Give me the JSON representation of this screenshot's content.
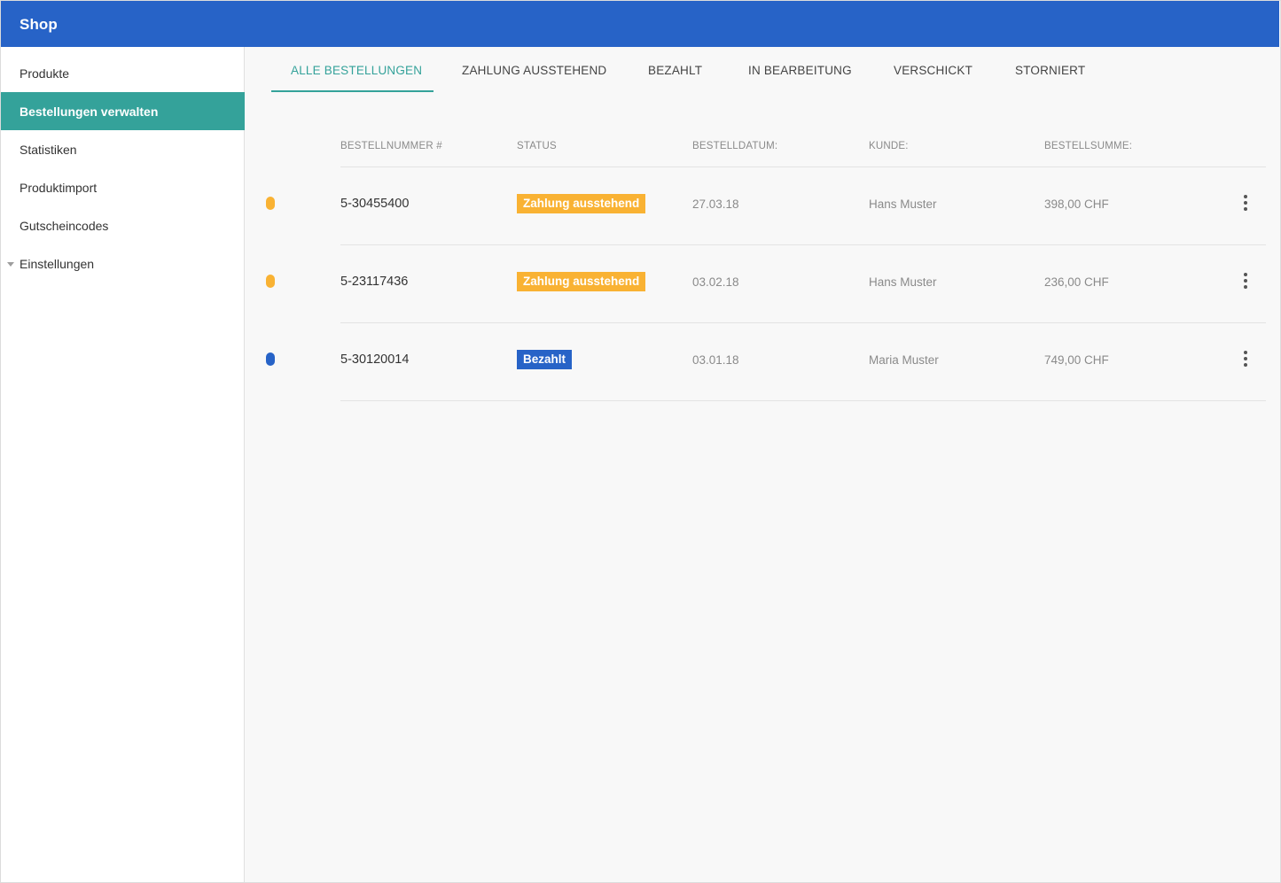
{
  "header": {
    "title": "Shop",
    "color": "#2763c7"
  },
  "sidebar": {
    "items": [
      {
        "label": "Produkte"
      },
      {
        "label": "Bestellungen verwalten",
        "active": true
      },
      {
        "label": "Statistiken"
      },
      {
        "label": "Produktimport"
      },
      {
        "label": "Gutscheincodes"
      },
      {
        "label": "Einstellungen",
        "icon": "caret-down-icon"
      }
    ],
    "active_color": "#34a29a"
  },
  "tabs": [
    {
      "label": "ALLE BESTELLUNGEN",
      "active": true
    },
    {
      "label": "ZAHLUNG AUSSTEHEND"
    },
    {
      "label": "BEZAHLT"
    },
    {
      "label": "IN BEARBEITUNG"
    },
    {
      "label": "VERSCHICKT"
    },
    {
      "label": "STORNIERT"
    }
  ],
  "table": {
    "columns": [
      "BESTELLNUMMER #",
      "STATUS",
      "BESTELLDATUM:",
      "KUNDE:",
      "BESTELLSUMME:"
    ],
    "rows": [
      {
        "order": "5-30455400",
        "status": "Zahlung ausstehend",
        "status_color": "#f9b233",
        "date": "27.03.18",
        "customer": "Hans Muster",
        "total": "398,00 CHF"
      },
      {
        "order": "5-23117436",
        "status": "Zahlung ausstehend",
        "status_color": "#f9b233",
        "date": "03.02.18",
        "customer": "Hans Muster",
        "total": "236,00 CHF"
      },
      {
        "order": "5-30120014",
        "status": "Bezahlt",
        "status_color": "#2763c7",
        "date": "03.01.18",
        "customer": "Maria Muster",
        "total": "749,00 CHF"
      }
    ]
  }
}
